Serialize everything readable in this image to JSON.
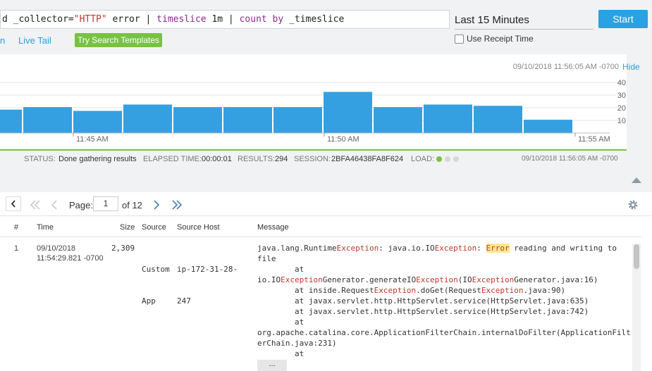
{
  "query": {
    "tokens": [
      {
        "t": "d _collector=",
        "c": "plain"
      },
      {
        "t": "\"HTTP\"",
        "c": "str"
      },
      {
        "t": " error | ",
        "c": "plain"
      },
      {
        "t": "timeslice",
        "c": "kw"
      },
      {
        "t": " 1m | ",
        "c": "plain"
      },
      {
        "t": "count by",
        "c": "kw"
      },
      {
        "t": " _timeslice",
        "c": "plain"
      }
    ]
  },
  "toolbar": {
    "time_range": "Last 15 Minutes",
    "start_label": "Start",
    "link_partial": "n",
    "live_tail": "Live Tail",
    "try_templates": "Try Search Templates",
    "use_receipt_time": "Use Receipt Time"
  },
  "histogram": {
    "timestamp": "09/10/2018 11:56:05 AM -0700",
    "hide_label": "Hide"
  },
  "chart_data": {
    "type": "bar",
    "values": [
      18.5,
      20.5,
      17.5,
      22.5,
      20.5,
      20.5,
      20.5,
      32.5,
      20.5,
      22.5,
      21.5,
      10.5
    ],
    "xticks": [
      "11:45 AM",
      "11:50 AM",
      "11:55 AM"
    ],
    "yticks": [
      "40",
      "30",
      "20",
      "10"
    ],
    "ylim": [
      0,
      40
    ],
    "color": "#34a0e2"
  },
  "status": {
    "status_key": "STATUS:",
    "status_val": "Done gathering results",
    "elapsed_key": "ELAPSED TIME:",
    "elapsed_val": "00:00:01",
    "results_key": "RESULTS:",
    "results_val": "294",
    "session_key": "SESSION:",
    "session_val": "2BFA46438FA8F624",
    "load_key": "LOAD:",
    "timestamp": "09/10/2018 11:56:05 AM -0700",
    "colors": {
      "active": "#79c143",
      "inactive": "#d5d8dc"
    }
  },
  "pager": {
    "page_label": "Page:",
    "page_value": "1",
    "of_label": "of 12"
  },
  "table": {
    "headers": {
      "num": "#",
      "time": "Time",
      "size": "Size",
      "source": "Source",
      "host": "Source Host",
      "message": "Message"
    },
    "row": {
      "num": "1",
      "time_line1": "09/10/2018",
      "time_line2": "11:54:29.821 -0700",
      "size": "2,309",
      "source_line1": "Custom",
      "source_line2": "App",
      "host_line1": "ip-172-31-28-",
      "host_line2": "247",
      "more_label": "..."
    },
    "message_lines": [
      [
        {
          "t": "java.lang.Runtime"
        },
        {
          "t": "Exception",
          "c": "ex"
        },
        {
          "t": ": java.io.IO"
        },
        {
          "t": "Exception",
          "c": "ex"
        },
        {
          "t": ": "
        },
        {
          "t": "Error",
          "c": "hl"
        },
        {
          "t": " reading and writing to"
        }
      ],
      [
        {
          "t": "file"
        }
      ],
      [
        {
          "t": "        at"
        }
      ],
      [
        {
          "t": "io.IO"
        },
        {
          "t": "Exception",
          "c": "ex"
        },
        {
          "t": "Generator.generateIO"
        },
        {
          "t": "Exception",
          "c": "ex"
        },
        {
          "t": "(IO"
        },
        {
          "t": "Exception",
          "c": "ex"
        },
        {
          "t": "Generator.java:16)"
        }
      ],
      [
        {
          "t": "        at inside.Request"
        },
        {
          "t": "Exception",
          "c": "ex"
        },
        {
          "t": ".doGet(Request"
        },
        {
          "t": "Exception",
          "c": "ex"
        },
        {
          "t": ".java:90)"
        }
      ],
      [
        {
          "t": "        at javax.servlet.http.HttpServlet.service(HttpServlet.java:635)"
        }
      ],
      [
        {
          "t": "        at javax.servlet.http.HttpServlet.service(HttpServlet.java:742)"
        }
      ],
      [
        {
          "t": "        at"
        }
      ],
      [
        {
          "t": "org.apache.catalina.core.ApplicationFilterChain.internalDoFilter(ApplicationFilt"
        }
      ],
      [
        {
          "t": "erChain.java:231)"
        }
      ],
      [
        {
          "t": "        at"
        }
      ]
    ]
  }
}
